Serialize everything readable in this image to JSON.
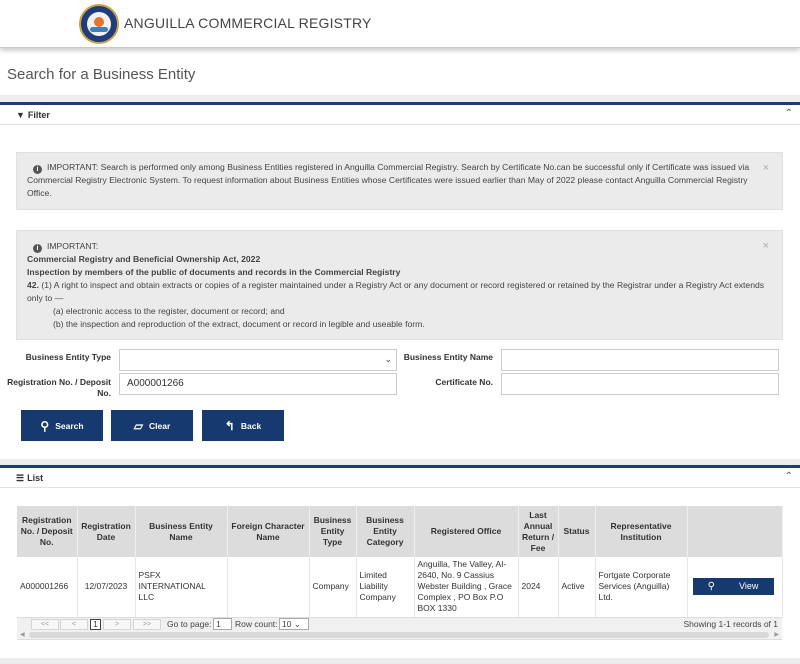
{
  "header": {
    "brand": "ANGUILLA COMMERCIAL REGISTRY"
  },
  "page": {
    "title": "Search for a Business Entity"
  },
  "filter": {
    "title": "Filter",
    "alert1_text": "IMPORTANT: Search is performed only among Business Entities registered in Anguilla Commercial Registry. Search by Certificate No.can be successful only if Certificate was issued via Commercial Registry Electronic System. To request information about Business Entities whose Certificates were issued earlier than May of 2022 please contact Anguilla Commercial Registry Office.",
    "alert2": {
      "heading": "IMPORTANT:",
      "act": "Commercial Registry and Beneficial Ownership Act, 2022",
      "section_title": "Inspection by members of the public of documents and records in the Commercial Registry",
      "section_no": "42.",
      "clause": " (1) A right to inspect and obtain extracts or copies of a register maintained under a Registry Act or any document or record registered or retained by the Registrar under a Registry Act extends only to —",
      "item_a": "(a) electronic access to the register, document or record; and",
      "item_b": "(b) the inspection and reproduction of the extract, document or record in legible and useable form."
    },
    "fields": {
      "entity_type_label": "Business Entity Type",
      "entity_type_value": "",
      "entity_name_label": "Business Entity Name",
      "entity_name_value": "",
      "reg_no_label_1": "Registration No. / Deposit",
      "reg_no_label_2": "No.",
      "reg_no_value": "A000001266",
      "cert_no_label": "Certificate No.",
      "cert_no_value": ""
    },
    "buttons": {
      "search": "Search",
      "clear": "Clear",
      "back": "Back"
    }
  },
  "list": {
    "title": "List",
    "columns": [
      "Registration No. / Deposit No.",
      "Registration Date",
      "Business Entity Name",
      "Foreign Character Name",
      "Business Entity Type",
      "Business Entity Category",
      "Registered Office",
      "Last Annual Return / Fee",
      "Status",
      "Representative Institution",
      ""
    ],
    "rows": [
      {
        "reg_no": "A000001266",
        "reg_date": "12/07/2023",
        "name": "PSFX INTERNATIONAL LLC",
        "foreign_name": "",
        "type": "Company",
        "category": "Limited Liability Company",
        "office": "Anguilla, The Valley, AI-2640, No. 9 Cassius Webster Building , Grace Complex , PO Box P.O BOX 1330",
        "last_return": "2024",
        "status": "Active",
        "institution": "Fortgate Corporate Services (Anguilla) Ltd.",
        "view_label": "View"
      }
    ],
    "pager": {
      "first": "<<",
      "prev": "<",
      "current_page": "1",
      "next": ">",
      "last": ">>",
      "goto_label": "Go to page:",
      "goto_value": "1",
      "row_count_label": "Row count:",
      "row_count_value": "10",
      "summary": "Showing 1-1 records of 1"
    }
  },
  "colors": {
    "primary": "#163a70",
    "panel_border": "#1b3e7a",
    "alert_bg": "#ebebeb",
    "page_bg": "#ededed"
  },
  "icons": [
    "logo-emblem",
    "filter-icon",
    "info-icon",
    "close-icon",
    "chevron-up-icon",
    "chevron-down-icon",
    "search-icon",
    "eraser-icon",
    "back-arrow-icon",
    "list-icon"
  ]
}
